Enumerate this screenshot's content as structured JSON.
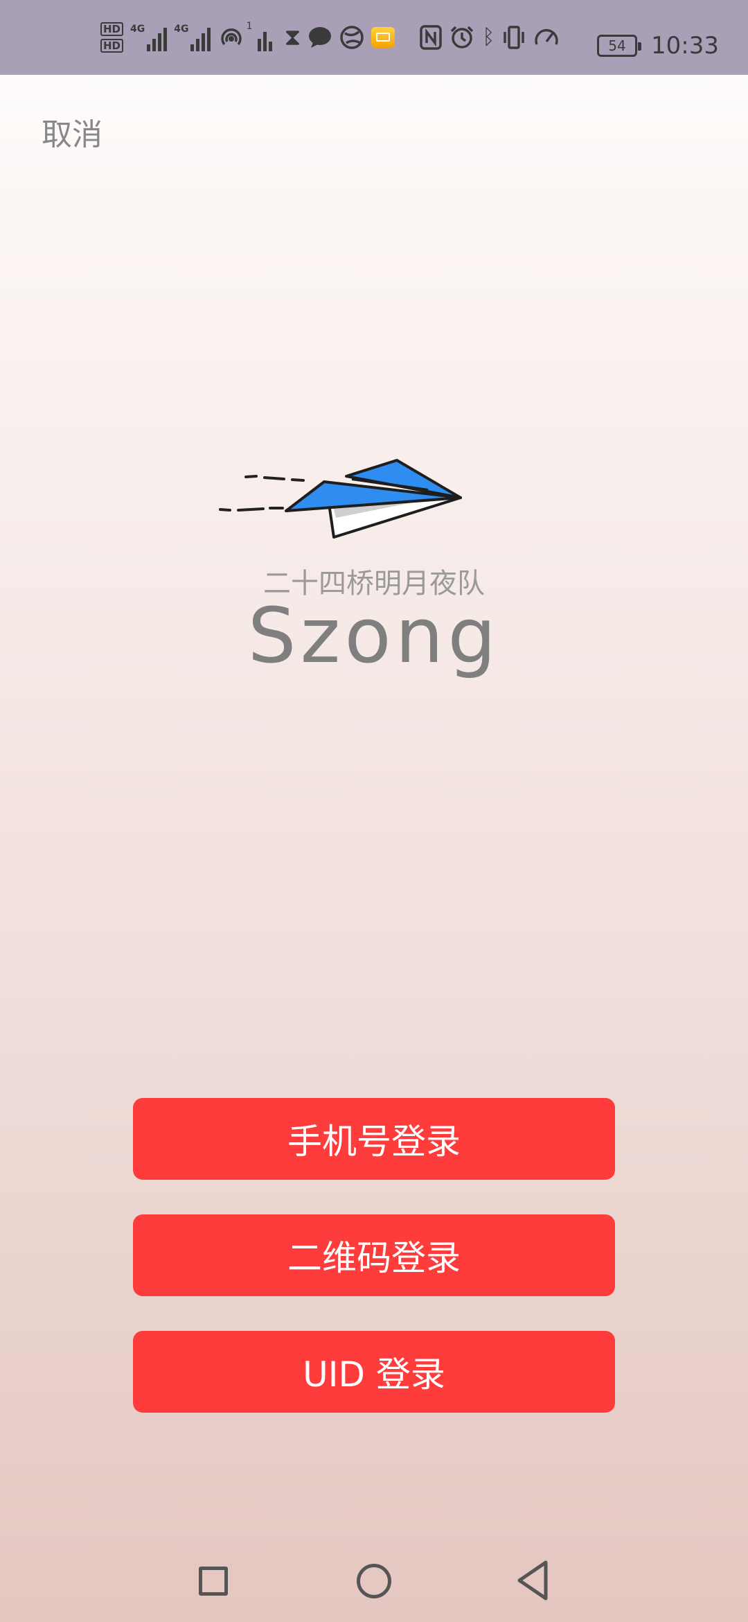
{
  "status_bar": {
    "sim1_label": "HD",
    "sim2_label": "HD",
    "sim1_net": "4G",
    "sim2_net": "4G",
    "hotspot_badge": "1",
    "battery": "54",
    "time": "10:33",
    "icons": [
      "hd-sim1-icon",
      "hd-sim2-icon",
      "signal-sim1-icon",
      "signal-sim2-icon",
      "hotspot-icon",
      "data-activity-icon",
      "hourglass-icon",
      "chat-icon",
      "browser-icon",
      "mail-icon",
      "nfc-icon",
      "alarm-icon",
      "bluetooth-icon",
      "vibrate-icon",
      "speed-icon",
      "battery-icon"
    ]
  },
  "header": {
    "cancel_label": "取消"
  },
  "logo": {
    "subtitle": "二十四桥明月夜队",
    "title": "Szong",
    "plane_color": "#2f8cf0",
    "icon": "paper-plane-icon"
  },
  "buttons": {
    "phone_login": "手机号登录",
    "qr_login": "二维码登录",
    "uid_login": "UID 登录",
    "color": "#ff3c3c"
  },
  "navbar": {
    "icons": [
      "recents-icon",
      "home-icon",
      "back-icon"
    ]
  }
}
